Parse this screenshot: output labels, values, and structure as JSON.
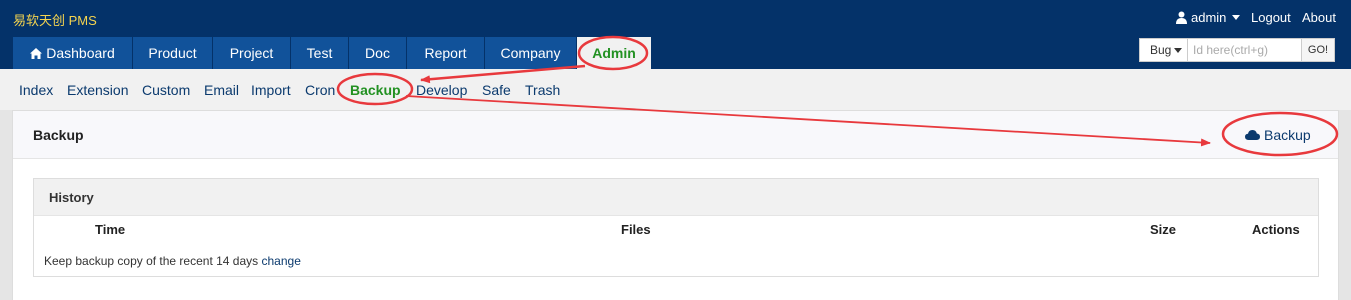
{
  "app": {
    "brand": "易软天创 PMS"
  },
  "userbar": {
    "username": "admin",
    "logout": "Logout",
    "about": "About"
  },
  "nav": {
    "tabs": [
      {
        "label": "Dashboard"
      },
      {
        "label": "Product"
      },
      {
        "label": "Project"
      },
      {
        "label": "Test"
      },
      {
        "label": "Doc"
      },
      {
        "label": "Report"
      },
      {
        "label": "Company"
      },
      {
        "label": "Admin"
      }
    ],
    "active": "Admin"
  },
  "search": {
    "type": "Bug",
    "placeholder": "Id here(ctrl+g)",
    "go": "GO!"
  },
  "subnav": {
    "items": [
      {
        "label": "Index"
      },
      {
        "label": "Extension"
      },
      {
        "label": "Custom"
      },
      {
        "label": "Email"
      },
      {
        "label": "Import"
      },
      {
        "label": "Cron"
      },
      {
        "label": "Backup"
      },
      {
        "label": "Develop"
      },
      {
        "label": "Safe"
      },
      {
        "label": "Trash"
      }
    ],
    "active": "Backup"
  },
  "panel": {
    "title": "Backup",
    "action_label": "Backup"
  },
  "history": {
    "title": "History",
    "columns": [
      "Time",
      "Files",
      "Size",
      "Actions"
    ],
    "note": "Keep backup copy of the recent 14 days",
    "note_link": "change"
  },
  "colors": {
    "header_bg": "#043269",
    "tab_bg": "#11529a",
    "active_green": "#229122",
    "brand_yellow": "#f5d44f",
    "link_blue": "#0b3a6e",
    "annotation_red": "#e8393d"
  },
  "icons": {
    "user": "user-icon",
    "home": "home-icon",
    "cloud": "cloud-icon"
  }
}
